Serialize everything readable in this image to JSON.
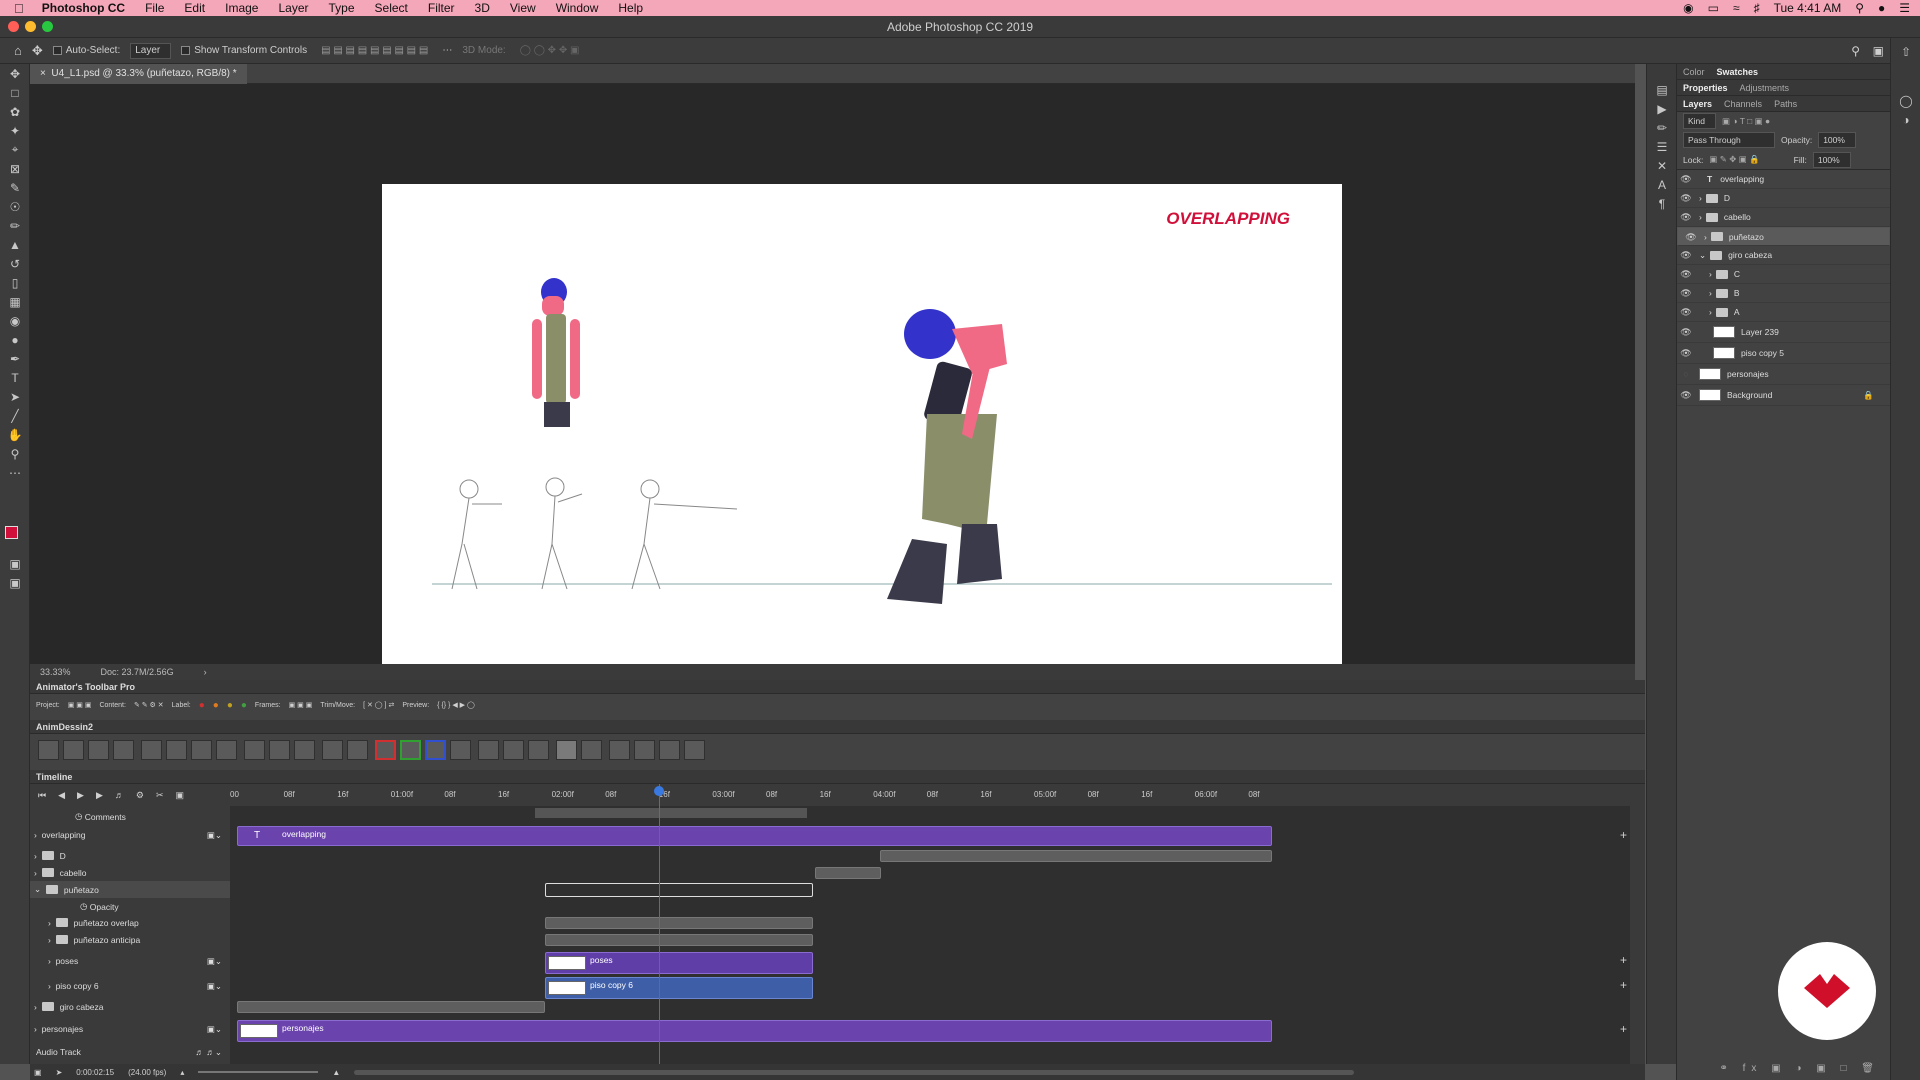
{
  "menubar": {
    "app": "Photoshop CC",
    "items": [
      "File",
      "Edit",
      "Image",
      "Layer",
      "Type",
      "Select",
      "Filter",
      "3D",
      "View",
      "Window",
      "Help"
    ],
    "clock": "Tue 4:41 AM"
  },
  "window": {
    "title": "Adobe Photoshop CC 2019"
  },
  "options": {
    "auto_select_label": "Auto-Select:",
    "auto_select_value": "Layer",
    "transform_label": "Show Transform Controls",
    "mode_3d": "3D Mode:"
  },
  "document": {
    "tab": "U4_L1.psd @ 33.3% (puñetazo, RGB/8) *",
    "canvas_title": "OVERLAPPING",
    "zoom": "33.33%",
    "doc_size": "Doc: 23.7M/2.56G"
  },
  "right": {
    "tabs_top": [
      "Color",
      "Swatches"
    ],
    "tabs_mid": [
      "Properties",
      "Adjustments"
    ],
    "tabs_layers": [
      "Layers",
      "Channels",
      "Paths"
    ],
    "kind": "Kind",
    "blend": "Pass Through",
    "opacity_label": "Opacity:",
    "opacity": "100%",
    "lock_label": "Lock:",
    "fill_label": "Fill:",
    "fill": "100%",
    "layers": [
      "overlapping",
      "D",
      "cabello",
      "puñetazo",
      "giro cabeza",
      "C",
      "B",
      "A",
      "Layer 239",
      "piso copy 5",
      "personajes",
      "Background"
    ]
  },
  "panels": {
    "animator_title": "Animator's Toolbar Pro",
    "animator_row": [
      "Project:",
      "Content:",
      "Label:",
      "Frames:",
      "Trim/Move:",
      "Preview:"
    ],
    "animdessin_title": "AnimDessin2",
    "timeline_title": "Timeline"
  },
  "timeline": {
    "ruler": [
      "00",
      "08f",
      "16f",
      "01:00f",
      "08f",
      "16f",
      "02:00f",
      "08f",
      "16f",
      "03:00f",
      "08f",
      "16f",
      "04:00f",
      "08f",
      "16f",
      "05:00f",
      "08f",
      "16f",
      "06:00f",
      "08f"
    ],
    "rows": [
      "Comments",
      "overlapping",
      "D",
      "cabello",
      "puñetazo",
      "Opacity",
      "puñetazo overlap",
      "puñetazo anticipa",
      "poses",
      "piso copy 6",
      "giro cabeza",
      "personajes",
      "Audio Track"
    ],
    "bars": {
      "overlapping": "overlapping",
      "poses": "poses",
      "piso": "piso copy 6",
      "personajes": "personajes"
    },
    "timecode": "0:00:02:15",
    "fps": "(24.00 fps)"
  },
  "colors": {
    "accent": "#6a43ad",
    "canvas_title": "#d0103a",
    "menubar": "#f4a7b9",
    "playhead": "#d04040"
  }
}
